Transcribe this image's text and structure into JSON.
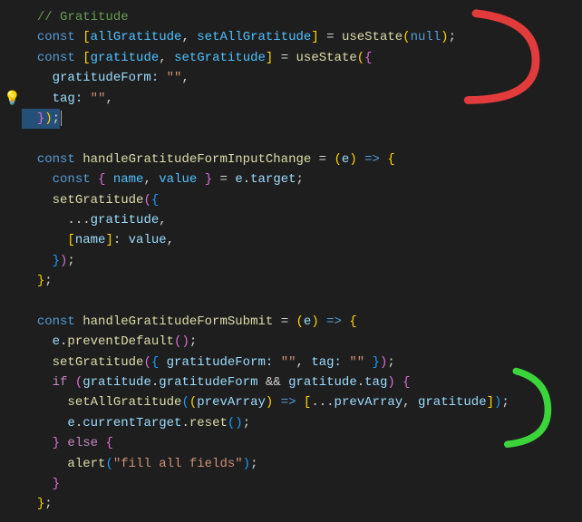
{
  "lines": {
    "l1_comment": "// Gratitude",
    "l2_const": "const",
    "l2_allGratitude": "allGratitude",
    "l2_setAllGratitude": "setAllGratitude",
    "l2_useState": "useState",
    "l2_null": "null",
    "l3_const": "const",
    "l3_gratitude": "gratitude",
    "l3_setGratitude": "setGratitude",
    "l3_useState": "useState",
    "l4_key": "gratitudeForm:",
    "l4_val": "\"\"",
    "l5_key": "tag:",
    "l5_val": "\"\"",
    "l8_const": "const",
    "l8_name": "handleGratitudeFormInputChange",
    "l8_eq": " = ",
    "l8_e": "e",
    "l9_const": "const",
    "l9_name": "name",
    "l9_value": "value",
    "l9_e": "e",
    "l9_target": "target",
    "l10_setGratitude": "setGratitude",
    "l11_gratitude": "gratitude",
    "l12_name": "name",
    "l12_value": "value",
    "l16_const": "const",
    "l16_name": "handleGratitudeFormSubmit",
    "l16_e": "e",
    "l17_e": "e",
    "l17_prevent": "preventDefault",
    "l18_setGratitude": "setGratitude",
    "l18_gratitudeForm": "gratitudeForm:",
    "l18_empty1": "\"\"",
    "l18_tag": "tag:",
    "l18_empty2": "\"\"",
    "l19_if": "if",
    "l19_gratitude1": "gratitude",
    "l19_gratitudeForm": "gratitudeForm",
    "l19_and": "&&",
    "l19_gratitude2": "gratitude",
    "l19_tag": "tag",
    "l20_setAll": "setAllGratitude",
    "l20_prevArray": "prevArray",
    "l20_prevArray2": "prevArray",
    "l20_gratitude": "gratitude",
    "l21_e": "e",
    "l21_currentTarget": "currentTarget",
    "l21_reset": "reset",
    "l22_else": "else",
    "l23_alert": "alert",
    "l23_msg": "\"fill all fields\"",
    "lightbulb": "💡"
  },
  "annotations": {
    "red_stroke": "#e23b3b",
    "green_stroke": "#3bd43b"
  }
}
